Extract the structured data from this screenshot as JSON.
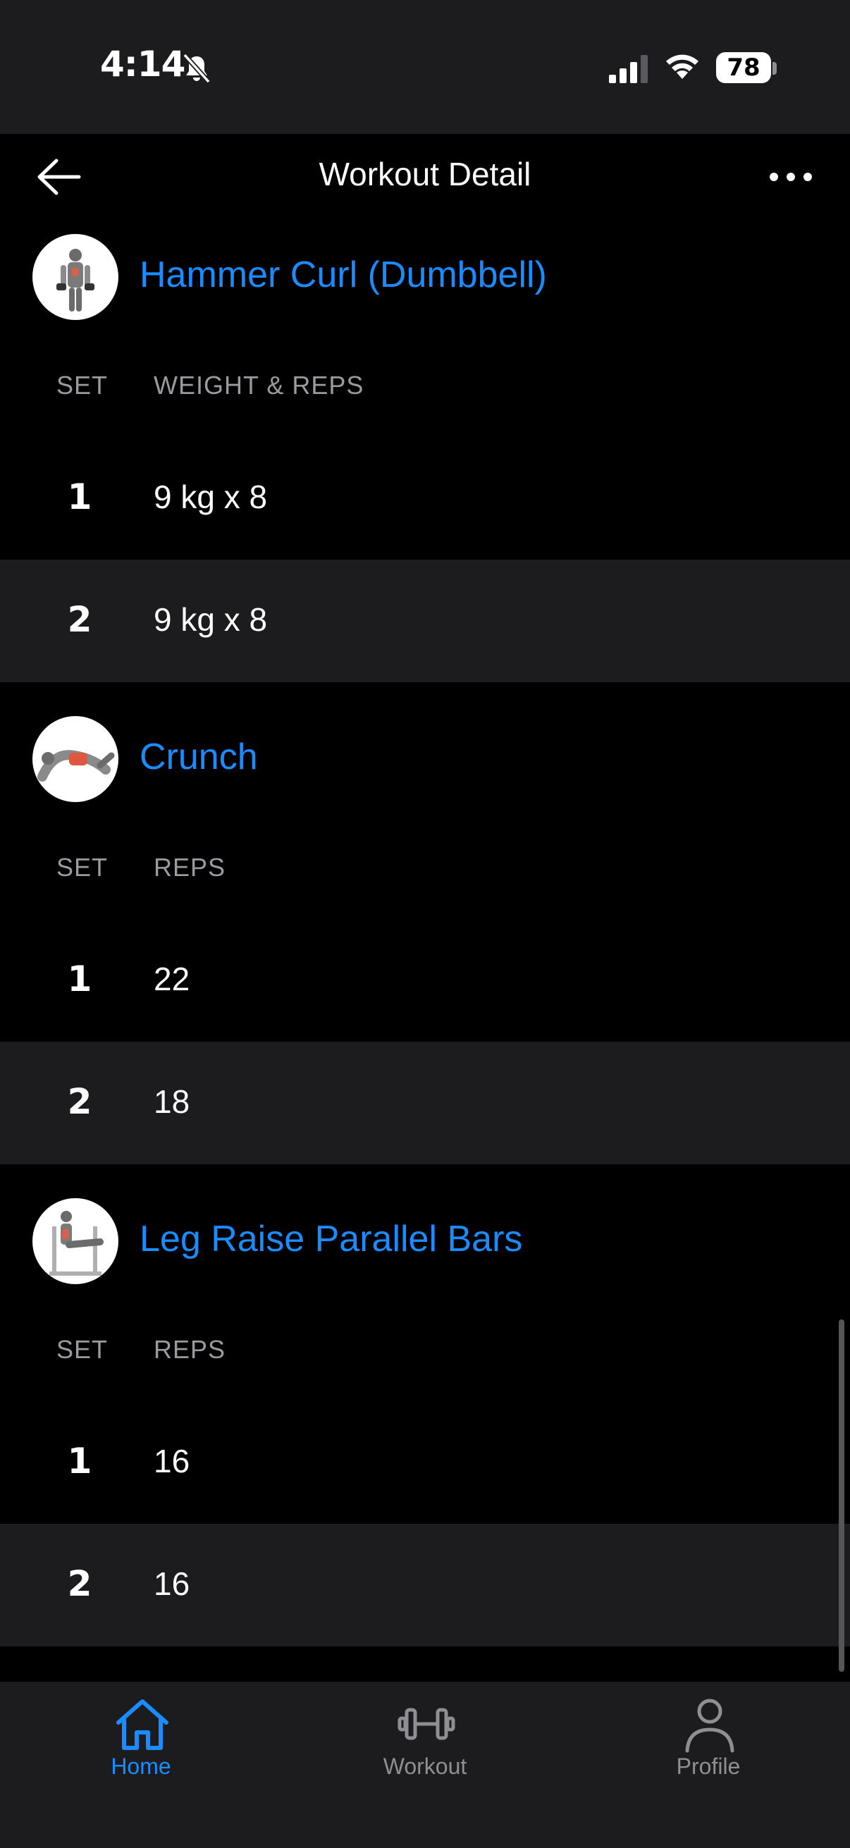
{
  "status_bar": {
    "time": "4:14",
    "battery": "78"
  },
  "nav": {
    "title": "Workout Detail"
  },
  "exercises": [
    {
      "name": "Hammer Curl (Dumbbell)",
      "col_set": "SET",
      "col_value": "WEIGHT & REPS",
      "sets": [
        {
          "num": "1",
          "value": "9 kg x 8"
        },
        {
          "num": "2",
          "value": "9 kg x 8"
        }
      ]
    },
    {
      "name": "Crunch",
      "col_set": "SET",
      "col_value": "REPS",
      "sets": [
        {
          "num": "1",
          "value": "22"
        },
        {
          "num": "2",
          "value": "18"
        }
      ]
    },
    {
      "name": "Leg Raise Parallel Bars",
      "col_set": "SET",
      "col_value": "REPS",
      "sets": [
        {
          "num": "1",
          "value": "16"
        },
        {
          "num": "2",
          "value": "16"
        }
      ]
    }
  ],
  "tab_bar": {
    "items": [
      {
        "label": "Home",
        "icon": "home-icon",
        "active": true
      },
      {
        "label": "Workout",
        "icon": "dumbbell-icon",
        "active": false
      },
      {
        "label": "Profile",
        "icon": "profile-icon",
        "active": false
      }
    ]
  },
  "colors": {
    "accent": "#1a8cff",
    "bar_bg": "#1c1c1e",
    "page_bg": "#000000"
  }
}
